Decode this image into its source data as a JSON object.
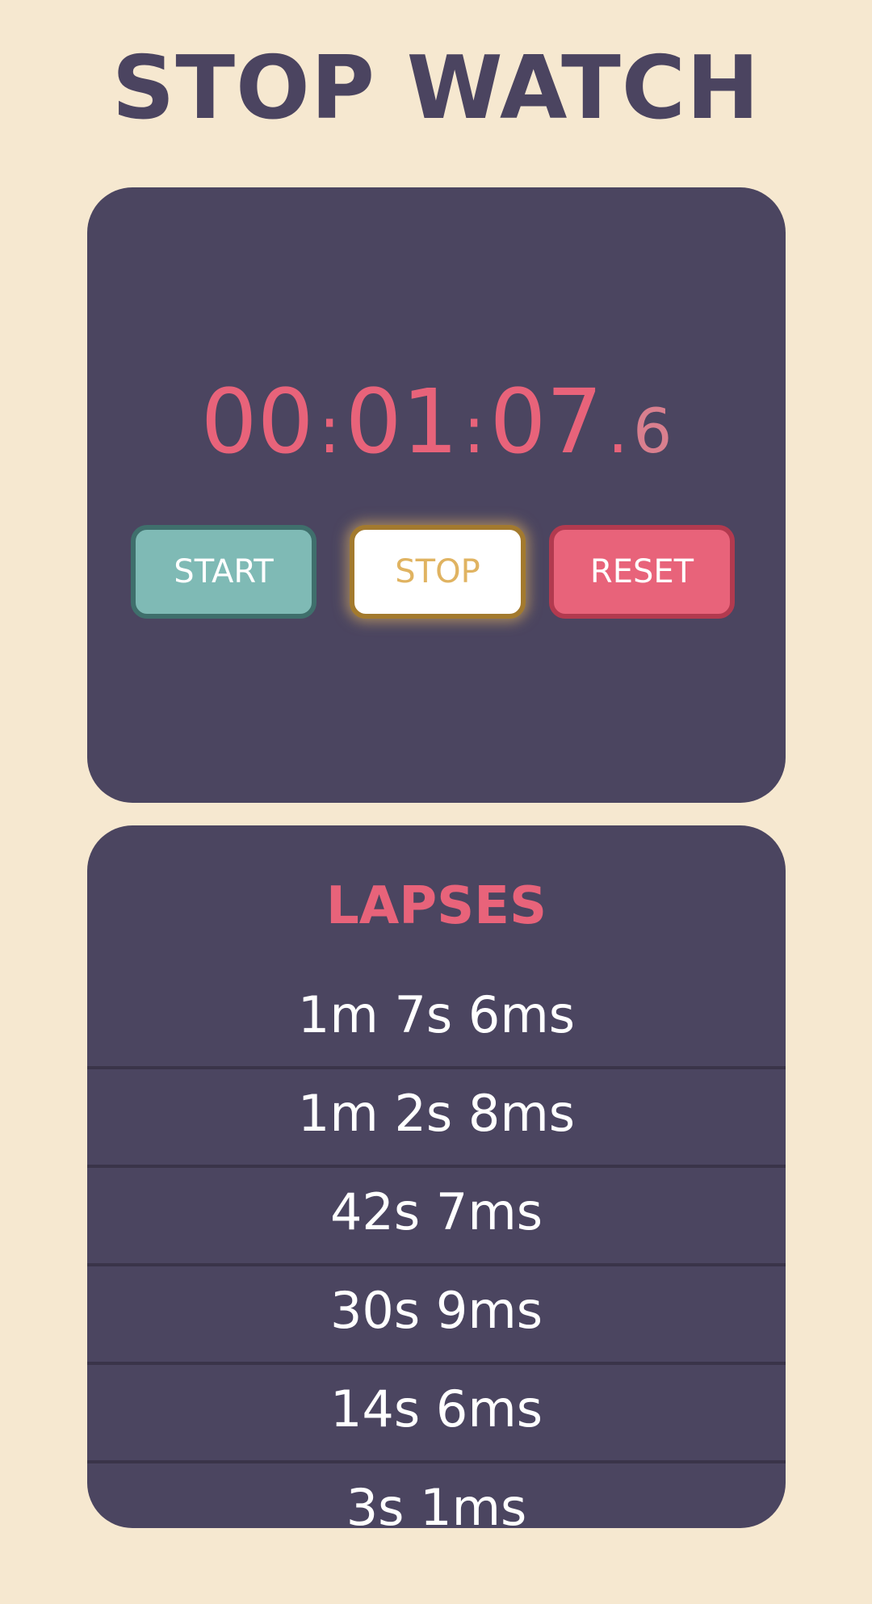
{
  "header": {
    "title": "STOP WATCH"
  },
  "timer": {
    "hours": "00",
    "minutes": "01",
    "seconds": "07",
    "tenths": "6",
    "sep1": ":",
    "sep2": ":",
    "sep3": "."
  },
  "controls": {
    "start_label": "START",
    "stop_label": "STOP",
    "reset_label": "RESET"
  },
  "laps": {
    "title": "LAPSES",
    "items": [
      "1m 7s 6ms",
      "1m 2s 8ms",
      "42s 7ms",
      "30s 9ms",
      "14s 6ms",
      "3s 1ms"
    ]
  },
  "colors": {
    "background": "#f6e8d0",
    "card": "#4b4560",
    "accent_pink": "#e8637a",
    "start_teal": "#7fbab5",
    "stop_gold": "#e0b361"
  }
}
